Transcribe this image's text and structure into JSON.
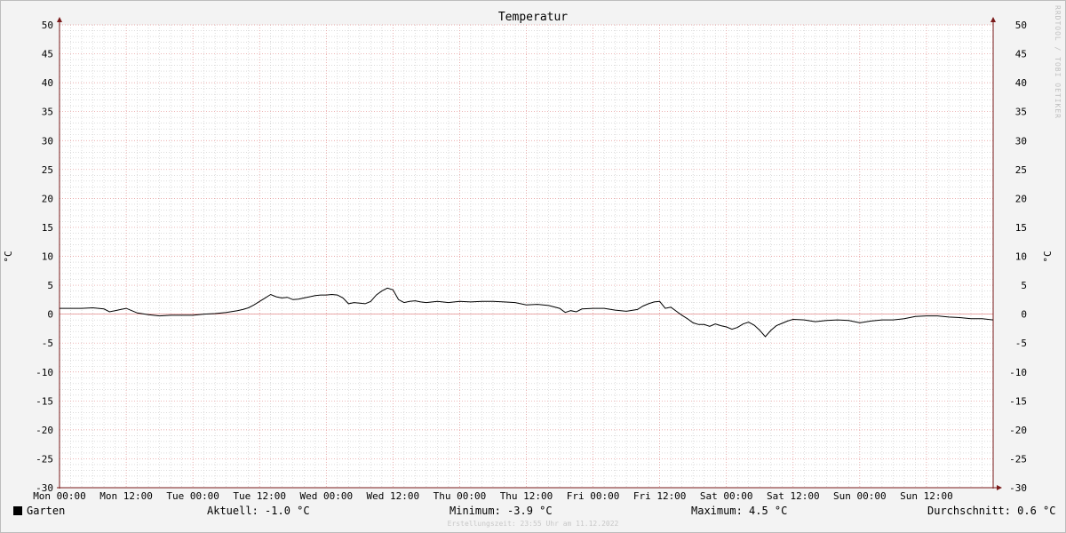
{
  "chart_data": {
    "type": "line",
    "title": "Temperatur",
    "ylabel": "°C",
    "ylabel_right": "°C",
    "ylim": [
      -30,
      50
    ],
    "yticks": [
      50,
      45,
      40,
      35,
      30,
      25,
      20,
      15,
      10,
      5,
      0,
      -5,
      -10,
      -15,
      -20,
      -25,
      -30
    ],
    "xlim_hours": [
      0,
      168
    ],
    "xticks": [
      "Mon 00:00",
      "Mon 12:00",
      "Tue 00:00",
      "Tue 12:00",
      "Wed 00:00",
      "Wed 12:00",
      "Thu 00:00",
      "Thu 12:00",
      "Fri 00:00",
      "Fri 12:00",
      "Sat 00:00",
      "Sat 12:00",
      "Sun 00:00",
      "Sun 12:00"
    ],
    "grid": true,
    "legend_placement": "bottom-left",
    "series": [
      {
        "name": "Garten",
        "color": "#000000",
        "points": [
          [
            0,
            1.0
          ],
          [
            2,
            1.0
          ],
          [
            4,
            1.0
          ],
          [
            6,
            1.1
          ],
          [
            8,
            0.9
          ],
          [
            9,
            0.4
          ],
          [
            10,
            0.6
          ],
          [
            11,
            0.8
          ],
          [
            12,
            1.0
          ],
          [
            13,
            0.6
          ],
          [
            14,
            0.2
          ],
          [
            16,
            -0.1
          ],
          [
            18,
            -0.3
          ],
          [
            20,
            -0.2
          ],
          [
            22,
            -0.2
          ],
          [
            24,
            -0.2
          ],
          [
            26,
            0.0
          ],
          [
            28,
            0.1
          ],
          [
            30,
            0.3
          ],
          [
            32,
            0.6
          ],
          [
            33,
            0.8
          ],
          [
            34,
            1.1
          ],
          [
            35,
            1.6
          ],
          [
            36,
            2.2
          ],
          [
            37,
            2.8
          ],
          [
            38,
            3.4
          ],
          [
            39,
            3.0
          ],
          [
            40,
            2.8
          ],
          [
            41,
            2.9
          ],
          [
            42,
            2.5
          ],
          [
            43,
            2.6
          ],
          [
            44,
            2.8
          ],
          [
            45,
            3.0
          ],
          [
            46,
            3.2
          ],
          [
            47,
            3.3
          ],
          [
            48,
            3.3
          ],
          [
            49,
            3.4
          ],
          [
            50,
            3.3
          ],
          [
            51,
            2.8
          ],
          [
            52,
            1.8
          ],
          [
            53,
            2.0
          ],
          [
            54,
            1.9
          ],
          [
            55,
            1.8
          ],
          [
            56,
            2.2
          ],
          [
            57,
            3.3
          ],
          [
            58,
            4.0
          ],
          [
            59,
            4.5
          ],
          [
            60,
            4.2
          ],
          [
            61,
            2.5
          ],
          [
            62,
            2.0
          ],
          [
            63,
            2.2
          ],
          [
            64,
            2.3
          ],
          [
            65,
            2.1
          ],
          [
            66,
            2.0
          ],
          [
            68,
            2.2
          ],
          [
            70,
            2.0
          ],
          [
            72,
            2.2
          ],
          [
            74,
            2.1
          ],
          [
            76,
            2.2
          ],
          [
            78,
            2.2
          ],
          [
            80,
            2.1
          ],
          [
            82,
            2.0
          ],
          [
            84,
            1.6
          ],
          [
            86,
            1.7
          ],
          [
            88,
            1.5
          ],
          [
            90,
            1.0
          ],
          [
            91,
            0.3
          ],
          [
            92,
            0.6
          ],
          [
            93,
            0.4
          ],
          [
            94,
            0.9
          ],
          [
            96,
            1.0
          ],
          [
            98,
            1.0
          ],
          [
            100,
            0.7
          ],
          [
            102,
            0.5
          ],
          [
            104,
            0.8
          ],
          [
            105,
            1.4
          ],
          [
            106,
            1.8
          ],
          [
            107,
            2.1
          ],
          [
            108,
            2.2
          ],
          [
            109,
            1.0
          ],
          [
            110,
            1.2
          ],
          [
            111,
            0.5
          ],
          [
            112,
            -0.2
          ],
          [
            113,
            -0.8
          ],
          [
            114,
            -1.5
          ],
          [
            115,
            -1.8
          ],
          [
            116,
            -1.8
          ],
          [
            117,
            -2.1
          ],
          [
            118,
            -1.7
          ],
          [
            119,
            -2.0
          ],
          [
            120,
            -2.2
          ],
          [
            121,
            -2.6
          ],
          [
            122,
            -2.3
          ],
          [
            123,
            -1.7
          ],
          [
            124,
            -1.4
          ],
          [
            125,
            -1.9
          ],
          [
            126,
            -2.8
          ],
          [
            127,
            -3.9
          ],
          [
            128,
            -2.8
          ],
          [
            129,
            -2.0
          ],
          [
            130,
            -1.6
          ],
          [
            131,
            -1.2
          ],
          [
            132,
            -0.9
          ],
          [
            134,
            -1.0
          ],
          [
            136,
            -1.3
          ],
          [
            138,
            -1.1
          ],
          [
            140,
            -1.0
          ],
          [
            142,
            -1.1
          ],
          [
            144,
            -1.5
          ],
          [
            146,
            -1.2
          ],
          [
            148,
            -1.0
          ],
          [
            150,
            -1.0
          ],
          [
            152,
            -0.8
          ],
          [
            154,
            -0.4
          ],
          [
            156,
            -0.3
          ],
          [
            158,
            -0.3
          ],
          [
            160,
            -0.5
          ],
          [
            162,
            -0.6
          ],
          [
            164,
            -0.8
          ],
          [
            166,
            -0.8
          ],
          [
            168,
            -1.0
          ]
        ]
      }
    ]
  },
  "legend": {
    "series_label": "Garten",
    "current": "Aktuell: -1.0 °C",
    "minimum": "Minimum: -3.9 °C",
    "maximum": "Maximum: 4.5 °C",
    "average": "Durchschnitt: 0.6 °C"
  },
  "footer": "Erstellungszeit: 23:55 Uhr am 11.12.2022",
  "watermark": "RRDTOOL / TOBI OETIKER",
  "colors": {
    "background": "#f3f3f3",
    "plot_background": "#ffffff",
    "major_grid": "#e38f8f",
    "minor_grid": "#c8c8c8",
    "axis": "#7a1a1a",
    "line": "#000000"
  }
}
